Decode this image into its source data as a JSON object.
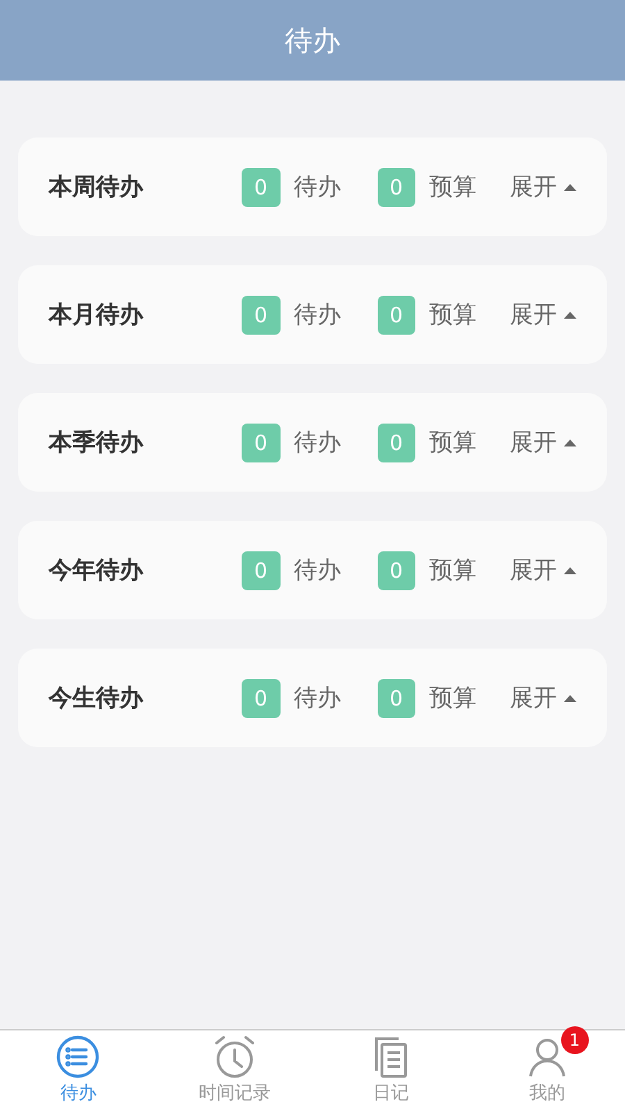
{
  "header": {
    "title": "待办"
  },
  "groups": [
    {
      "title": "本周待办",
      "todo_count": "0",
      "todo_label": "待办",
      "budget_count": "0",
      "budget_label": "预算",
      "toggle": "展开"
    },
    {
      "title": "本月待办",
      "todo_count": "0",
      "todo_label": "待办",
      "budget_count": "0",
      "budget_label": "预算",
      "toggle": "展开"
    },
    {
      "title": "本季待办",
      "todo_count": "0",
      "todo_label": "待办",
      "budget_count": "0",
      "budget_label": "预算",
      "toggle": "展开"
    },
    {
      "title": "今年待办",
      "todo_count": "0",
      "todo_label": "待办",
      "budget_count": "0",
      "budget_label": "预算",
      "toggle": "展开"
    },
    {
      "title": "今生待办",
      "todo_count": "0",
      "todo_label": "待办",
      "budget_count": "0",
      "budget_label": "预算",
      "toggle": "展开"
    }
  ],
  "tabs": [
    {
      "kind": "list",
      "label": "待办",
      "selected": true
    },
    {
      "kind": "clock",
      "label": "时间记录",
      "selected": false
    },
    {
      "kind": "diary",
      "label": "日记",
      "selected": false
    },
    {
      "kind": "person",
      "label": "我的",
      "selected": false,
      "badge": "1"
    }
  ]
}
